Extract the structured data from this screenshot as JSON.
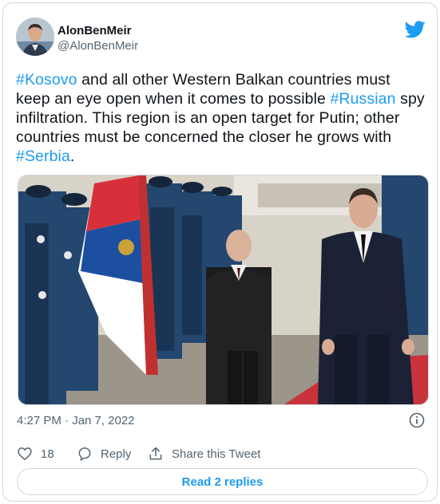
{
  "author": {
    "display_name": "AlonBenMeir",
    "handle": "@AlonBenMeir"
  },
  "tweet": {
    "segments": [
      {
        "text": "#Kosovo",
        "hashtag": true
      },
      {
        "text": " and all other Western Balkan countries must keep an eye open when it comes to possible ",
        "hashtag": false
      },
      {
        "text": "#Russian",
        "hashtag": true
      },
      {
        "text": " spy infiltration. This region is an open target for Putin; other countries must be concerned the closer he grows with ",
        "hashtag": false
      },
      {
        "text": "#Serbia",
        "hashtag": true
      },
      {
        "text": ".",
        "hashtag": false
      }
    ]
  },
  "timestamp": "4:27 PM · Jan 7, 2022",
  "actions": {
    "like_count": "18",
    "reply_label": "Reply",
    "share_label": "Share this Tweet"
  },
  "read_replies_label": "Read 2 replies",
  "icons": {
    "brand": "twitter-bird-icon",
    "info": "info-icon",
    "like": "heart-icon",
    "reply": "reply-bubble-icon",
    "share": "share-arrow-icon"
  },
  "colors": {
    "accent": "#1d9bf0",
    "text": "#0f1419",
    "secondary": "#536471",
    "border": "#cfd9de"
  }
}
